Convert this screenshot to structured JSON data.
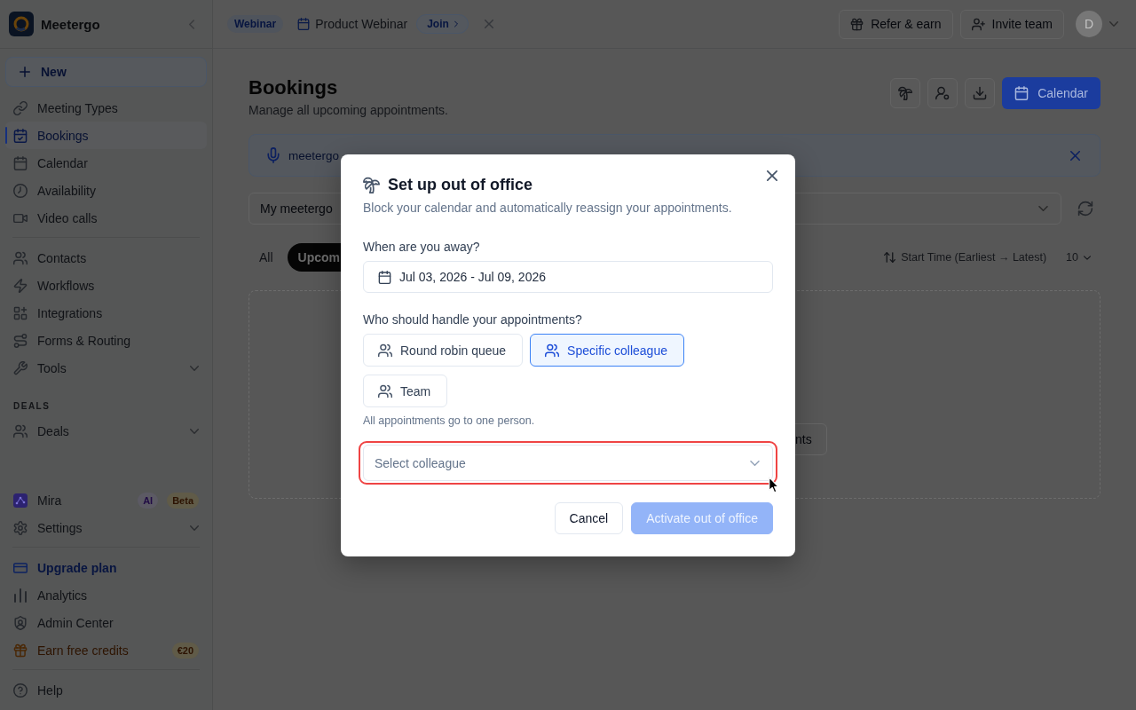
{
  "sidebar": {
    "brand": "Meetergo",
    "new_button": "New",
    "sections": [
      {
        "items": [
          {
            "label": "Meeting Types",
            "kind": "link",
            "selected": false
          },
          {
            "label": "Bookings",
            "kind": "link",
            "selected": true
          },
          {
            "label": "Calendar",
            "kind": "link",
            "selected": false
          },
          {
            "label": "Availability",
            "kind": "link",
            "selected": false
          },
          {
            "label": "Video calls",
            "kind": "link",
            "selected": false
          }
        ]
      },
      {
        "items": [
          {
            "label": "Contacts",
            "kind": "link",
            "selected": false
          },
          {
            "label": "Workflows",
            "kind": "link",
            "selected": false
          },
          {
            "label": "Integrations",
            "kind": "link",
            "selected": false
          },
          {
            "label": "Forms & Routing",
            "kind": "link",
            "selected": false
          },
          {
            "label": "Tools",
            "kind": "group",
            "selected": false
          }
        ]
      },
      {
        "title": "DEALS",
        "items": [
          {
            "label": "Deals",
            "kind": "group",
            "selected": false
          }
        ]
      }
    ],
    "footer_sections": [
      {
        "items": [
          {
            "label": "Mira",
            "kind": "assistant",
            "selected": false,
            "badges": [
              {
                "text": "AI",
                "kind": "ai"
              },
              {
                "text": "Beta",
                "kind": "beta"
              }
            ]
          },
          {
            "label": "Settings",
            "kind": "group",
            "selected": false
          }
        ]
      },
      {
        "items": [
          {
            "label": "Upgrade plan",
            "kind": "upgrade",
            "selected": false
          },
          {
            "label": "Analytics",
            "kind": "link",
            "selected": false
          },
          {
            "label": "Admin Center",
            "kind": "link",
            "selected": false
          },
          {
            "label": "Earn free credits",
            "kind": "reward",
            "selected": false,
            "badges": [
              {
                "text": "€20",
                "kind": "amount"
              }
            ]
          }
        ]
      },
      {
        "items": [
          {
            "label": "Help",
            "kind": "link",
            "selected": false
          }
        ]
      }
    ]
  },
  "top_bar": {
    "event_badge": "Webinar",
    "event_title": "Product Webinar",
    "join_button": "Join",
    "actions": [
      "Refer & earn",
      "Invite team"
    ],
    "avatar_initial": "D"
  },
  "page": {
    "title": "Bookings",
    "subtitle": "Manage all upcoming appointments.",
    "calendar_button": "Calendar"
  },
  "banner": {
    "text": "meetergo"
  },
  "filter": {
    "value": "My meetergo"
  },
  "tabs": [
    {
      "label": "All",
      "selected": false
    },
    {
      "label": "Upcom",
      "selected": true
    }
  ],
  "sort": {
    "label": "Start Time (Earliest → Latest)",
    "page_size": "10"
  },
  "empty_state": {
    "button": "nts"
  },
  "modal": {
    "title": "Set up out of office",
    "subtitle": "Block your calendar and automatically reassign your appointments.",
    "date_label": "When are you away?",
    "date_range": "Jul 03, 2026 - Jul 09, 2026",
    "handler_label": "Who should handle your appointments?",
    "handlers": [
      {
        "label": "Round robin queue",
        "selected": false
      },
      {
        "label": "Specific colleague",
        "selected": true
      },
      {
        "label": "Team",
        "selected": false
      }
    ],
    "hint": "All appointments go to one person.",
    "colleague_select": {
      "placeholder": "Select colleague",
      "highlighted": true
    },
    "buttons": [
      {
        "label": "Cancel",
        "kind": "secondary",
        "disabled": false
      },
      {
        "label": "Activate out of office",
        "kind": "primary",
        "disabled": true
      }
    ]
  }
}
